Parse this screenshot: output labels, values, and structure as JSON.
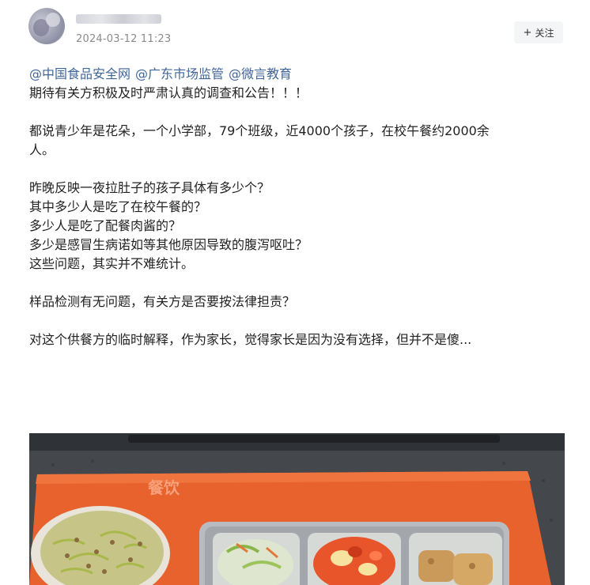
{
  "header": {
    "timestamp": "2024-03-12 11:23",
    "follow_icon": "+",
    "follow_label": "关注"
  },
  "post": {
    "mentions": [
      "@中国食品安全网",
      "@广东市场监管",
      "@微言教育"
    ],
    "paragraphs": [
      [
        "期待有关方积极及时严肃认真的调查和公告！！！"
      ],
      [
        "都说青少年是花朵，一个小学部，79个班级，近4000个孩子，在校午餐约2000余",
        "人。"
      ],
      [
        "昨晚反映一夜拉肚子的孩子具体有多少个？",
        "其中多少人是吃了在校午餐的？",
        "多少人是吃了配餐肉酱的？",
        "多少是感冒生病诺如等其他原因导致的腹泻呕吐？",
        "这些问题，其实并不难统计。"
      ],
      [
        "样品检测有无问题，有关方是否要按法律担责？"
      ],
      [
        "对这个供餐方的临时解释，作为家长，觉得家长是因为没有选择，但并不是傻..."
      ]
    ]
  },
  "photo": {
    "placemat_text": "餐饮",
    "colors": {
      "placemat": "#e8622e",
      "tray": "#b8bcc0",
      "counter": "#46494d"
    }
  }
}
